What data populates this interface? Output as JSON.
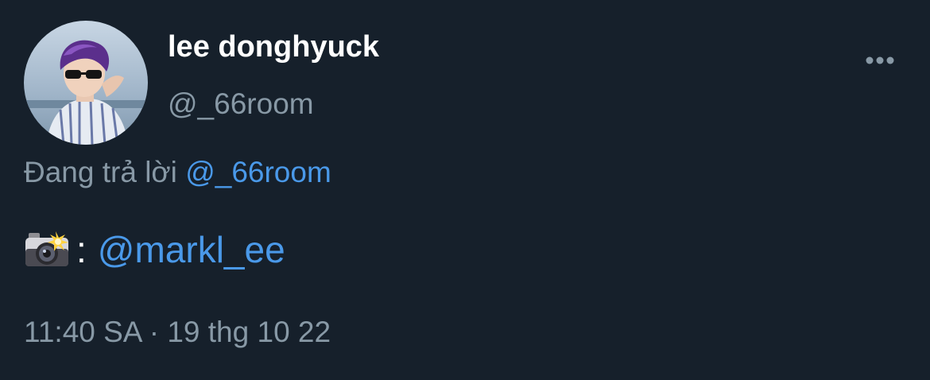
{
  "tweet": {
    "author": {
      "display_name": "lee donghyuck",
      "handle": "@_66room",
      "avatar_icon": "profile-photo"
    },
    "more_icon": "more-horizontal-icon",
    "reply": {
      "prefix": "Đang trả lời",
      "mention": "@_66room"
    },
    "body": {
      "emoji_icon": "camera-with-flash-icon",
      "separator": ":",
      "mention": "@markl_ee"
    },
    "timestamp": {
      "time": "11:40 SA",
      "separator": "·",
      "date": "19 thg 10 22"
    }
  },
  "colors": {
    "background": "#16202b",
    "primary_text": "#ffffff",
    "secondary_text": "#8899a6",
    "link": "#4a99e9"
  }
}
